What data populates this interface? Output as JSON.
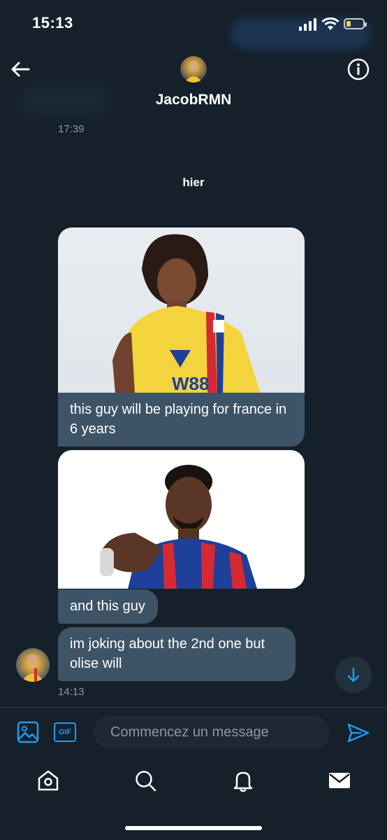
{
  "status_bar": {
    "time": "15:13"
  },
  "header": {
    "username": "JacobRMN"
  },
  "thread": {
    "previous_time": "17:39",
    "day_separator": "hier",
    "messages": [
      {
        "text": "this guy will be playing for france in 6 years",
        "has_image": true,
        "image_jersey": "W88"
      },
      {
        "text": "and this guy",
        "has_image": true
      },
      {
        "text": "im joking about the 2nd one but olise will",
        "has_image": false
      }
    ],
    "last_time": "14:13"
  },
  "composer": {
    "gif_label": "GIF",
    "placeholder": "Commencez un message"
  },
  "colors": {
    "accent": "#1d9bf0",
    "background": "#15202b",
    "bubble": "#3d5466"
  },
  "tabbar": {
    "icons": [
      "home-icon",
      "search-icon",
      "notifications-icon",
      "messages-icon"
    ]
  }
}
